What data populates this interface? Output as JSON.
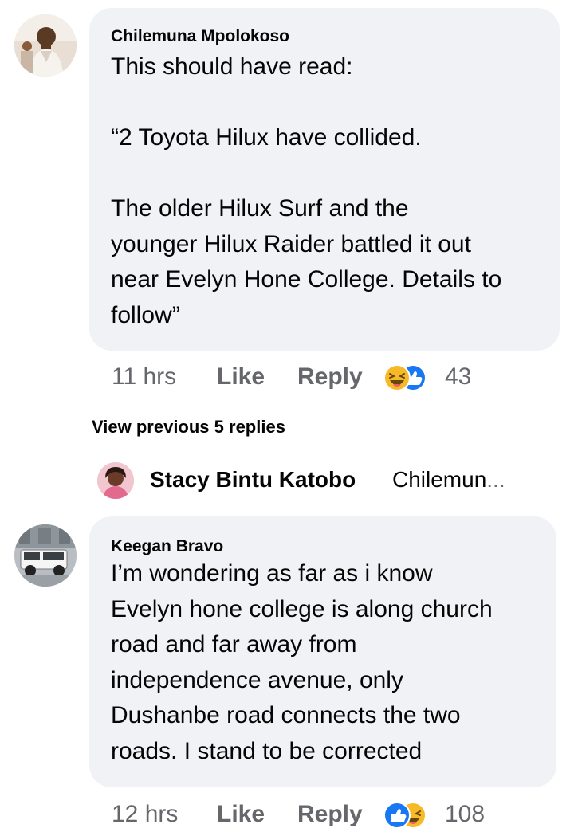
{
  "comments": [
    {
      "author": "Chilemuna Mpolokoso",
      "text": "This should have read:\n\n“2 Toyota Hilux have collided.\n\nThe older Hilux Surf and the\nyounger Hilux Raider battled it out\nnear Evelyn Hone College. Details to\nfollow”",
      "time": "11 hrs",
      "like_label": "Like",
      "reply_label": "Reply",
      "reaction_icons": [
        "haha-icon",
        "like-icon"
      ],
      "reaction_count": "43"
    },
    {
      "author": "Keegan Bravo",
      "text": "I’m wondering as far as i know\nEvelyn hone college is along church\nroad and far away from\nindependence avenue, only\nDushanbe road connects the two\nroads. I stand to be corrected",
      "time": "12 hrs",
      "like_label": "Like",
      "reply_label": "Reply",
      "reaction_icons": [
        "like-icon",
        "haha-icon"
      ],
      "reaction_count": "108"
    }
  ],
  "view_previous": "View previous 5 replies",
  "reply_preview": {
    "author": "Stacy Bintu Katobo",
    "snippet": "Chilemun",
    "ellipsis": "..."
  },
  "colors": {
    "bubble": "#f0f2f5",
    "meta": "#65676b",
    "like_blue": "#1877f2",
    "haha_yellow": "#f7b928"
  }
}
